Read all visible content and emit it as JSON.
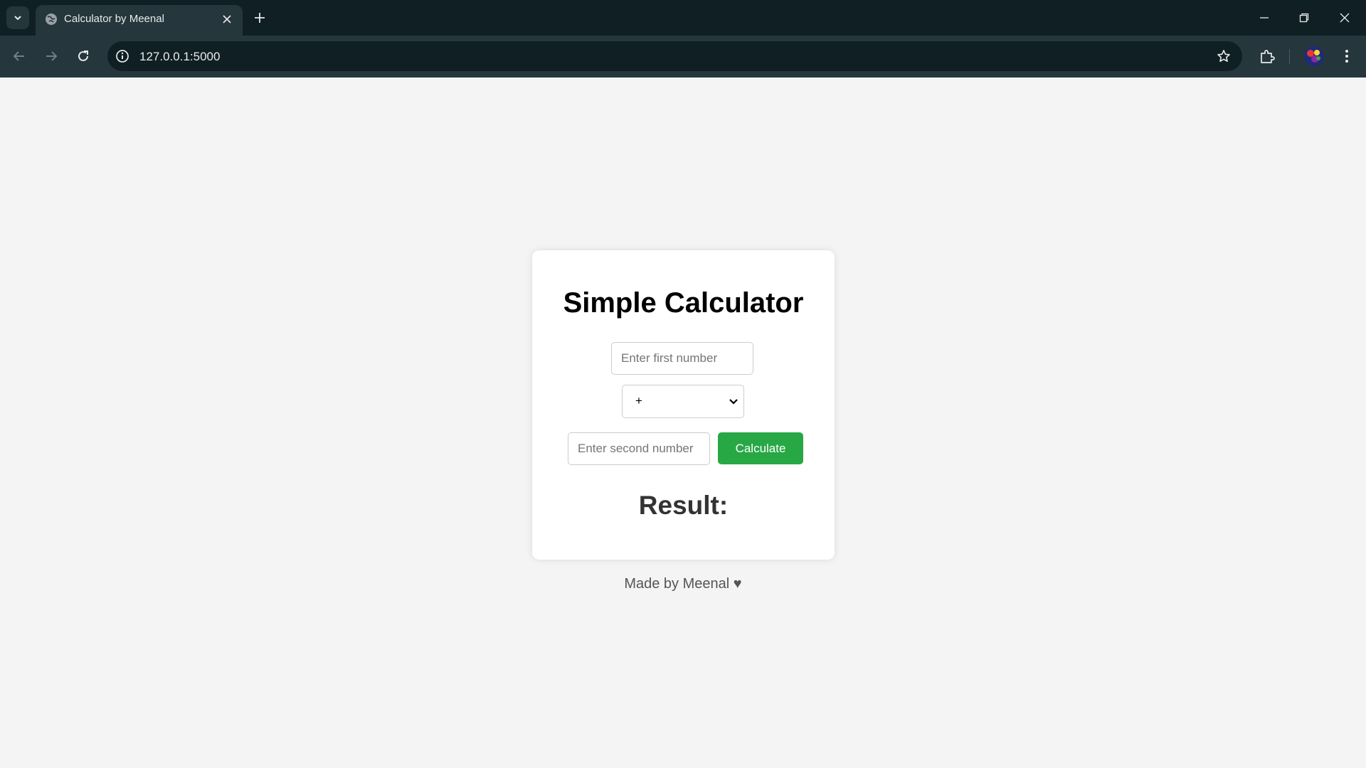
{
  "browser": {
    "tab_title": "Calculator by Meenal",
    "url": "127.0.0.1:5000"
  },
  "calculator": {
    "title": "Simple Calculator",
    "first_number": {
      "value": "",
      "placeholder": "Enter first number"
    },
    "operation": {
      "selected": "+",
      "options": [
        "+"
      ]
    },
    "second_number": {
      "value": "",
      "placeholder": "Enter second number"
    },
    "calculate_label": "Calculate",
    "result_label": "Result:"
  },
  "footer": {
    "text": "Made by Meenal ♥"
  },
  "colors": {
    "chrome_dark": "#0f1f24",
    "chrome_toolbar": "#25373c",
    "page_bg": "#f4f4f4",
    "button_green": "#28a745"
  }
}
